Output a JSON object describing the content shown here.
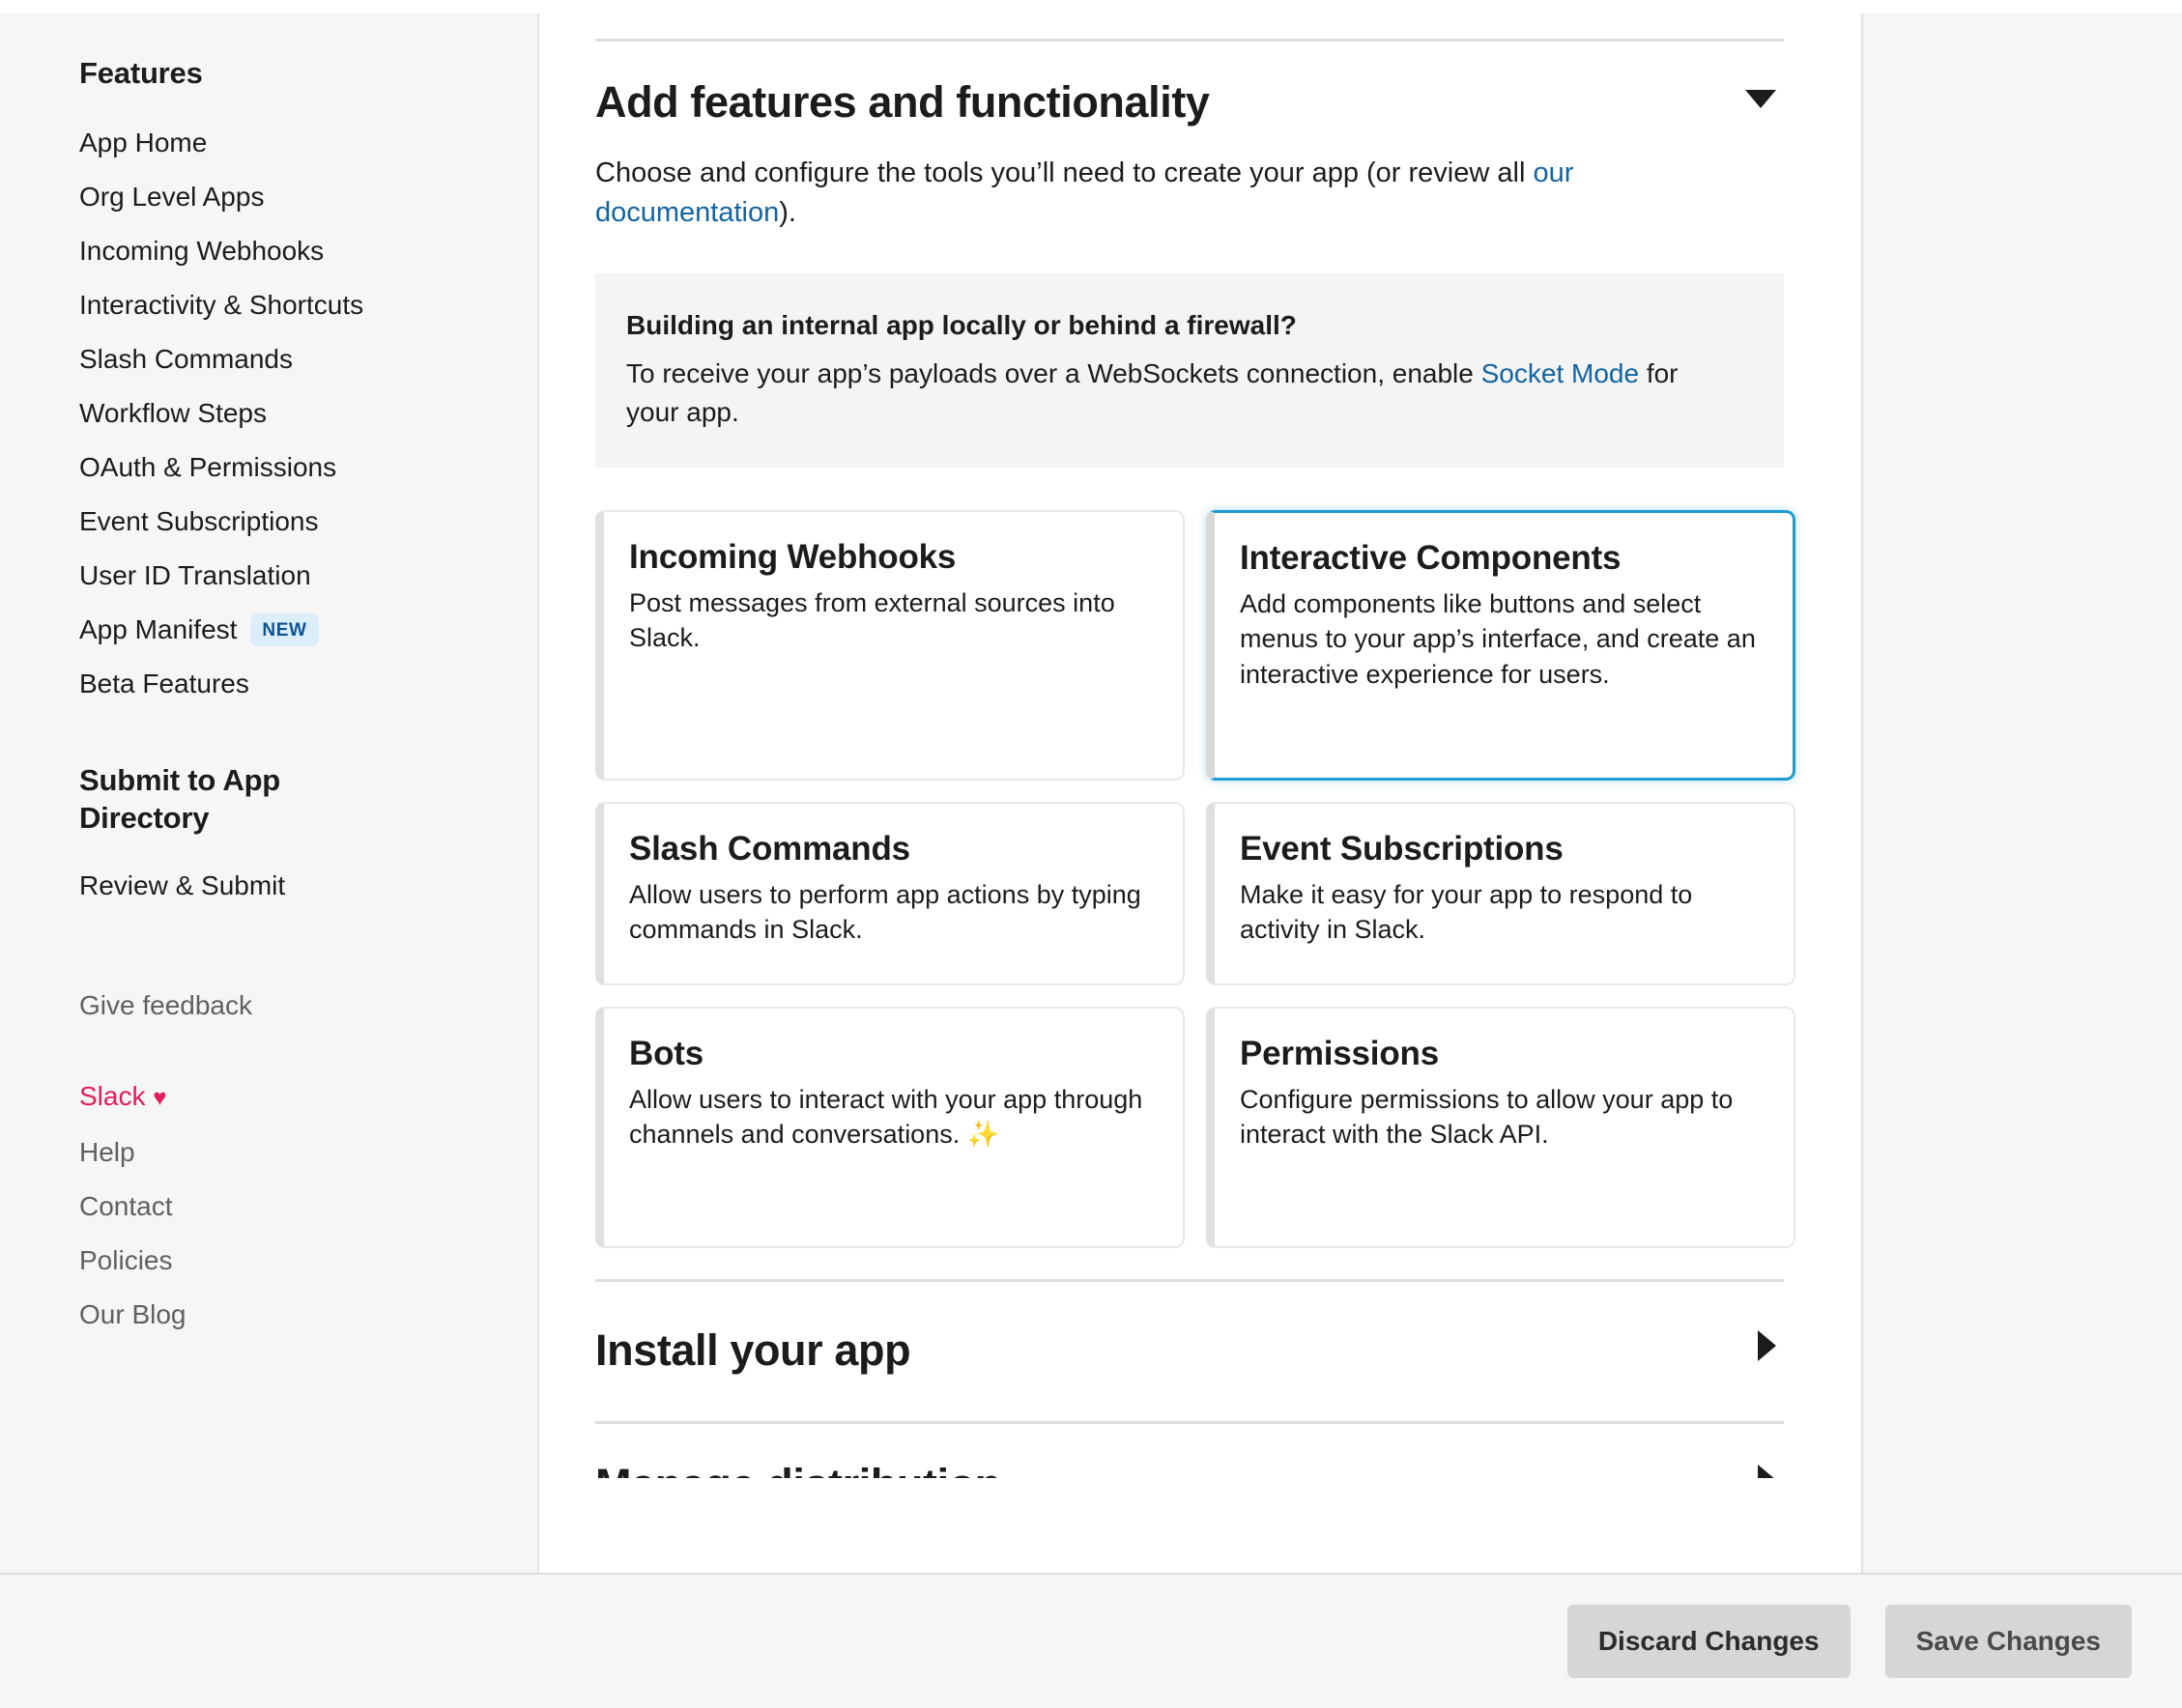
{
  "sidebar": {
    "features_heading": "Features",
    "feature_items": [
      {
        "label": "App Home"
      },
      {
        "label": "Org Level Apps"
      },
      {
        "label": "Incoming Webhooks"
      },
      {
        "label": "Interactivity & Shortcuts"
      },
      {
        "label": "Slash Commands"
      },
      {
        "label": "Workflow Steps"
      },
      {
        "label": "OAuth & Permissions"
      },
      {
        "label": "Event Subscriptions"
      },
      {
        "label": "User ID Translation"
      },
      {
        "label": "App Manifest",
        "badge": "NEW"
      },
      {
        "label": "Beta Features"
      }
    ],
    "submit_heading": "Submit to App Directory",
    "submit_items": [
      {
        "label": "Review & Submit"
      }
    ],
    "feedback_label": "Give feedback",
    "slack_love_label": "Slack",
    "slack_love_heart": "♥",
    "footer_items": [
      {
        "label": "Help"
      },
      {
        "label": "Contact"
      },
      {
        "label": "Policies"
      },
      {
        "label": "Our Blog"
      }
    ]
  },
  "main": {
    "features_section": {
      "title": "Add features and functionality",
      "toggle_icon": "chevron-down",
      "description_prefix": "Choose and configure the tools you’ll need to create your app (or review all ",
      "description_link": "our documentation",
      "description_suffix": ").",
      "callout": {
        "title": "Building an internal app locally or behind a firewall?",
        "body_prefix": "To receive your app’s payloads over a WebSockets connection, enable ",
        "body_link": "Socket Mode",
        "body_suffix": " for your app."
      },
      "cards": [
        {
          "title": "Incoming Webhooks",
          "description": "Post messages from external sources into Slack.",
          "selected": false
        },
        {
          "title": "Interactive Components",
          "description": "Add components like buttons and select menus to your app’s interface, and create an interactive experience for users.",
          "selected": true
        },
        {
          "title": "Slash Commands",
          "description": "Allow users to perform app actions by typing commands in Slack.",
          "selected": false
        },
        {
          "title": "Event Subscriptions",
          "description": "Make it easy for your app to respond to activity in Slack.",
          "selected": false
        },
        {
          "title": "Bots",
          "description": "Allow users to interact with your app through channels and conversations. ✨",
          "selected": false
        },
        {
          "title": "Permissions",
          "description": "Configure permissions to allow your app to interact with the Slack API.",
          "selected": false
        }
      ]
    },
    "install_section": {
      "title": "Install your app",
      "toggle_icon": "chevron-right"
    },
    "next_section": {
      "title": "Manage distribution",
      "toggle_icon": "chevron-right"
    }
  },
  "action_bar": {
    "discard_label": "Discard Changes",
    "save_label": "Save Changes"
  },
  "colors": {
    "accent_blue": "#1d9bd1",
    "link_blue": "#1264a3",
    "slack_pink": "#e01e5a",
    "badge_bg": "#ddeefb",
    "badge_text": "#0b5394",
    "page_bg": "#f6f6f6"
  }
}
